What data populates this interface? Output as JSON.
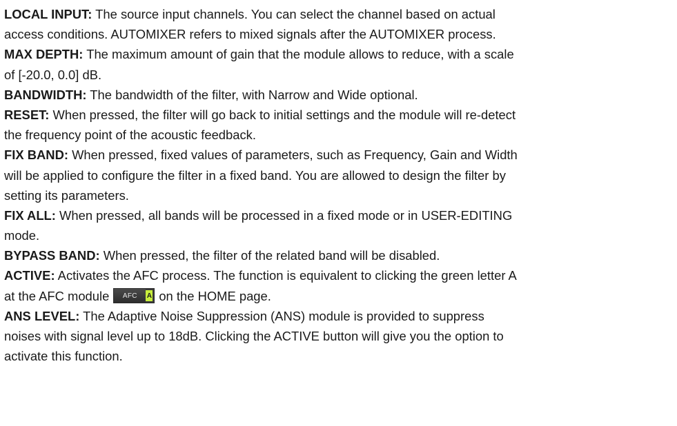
{
  "entries": [
    {
      "term": "LOCAL INPUT:",
      "lines": [
        " The source input channels. You can select the channel based on actual",
        "access conditions. AUTOMIXER refers to mixed signals after the AUTOMIXER process."
      ]
    },
    {
      "term": "MAX DEPTH:",
      "lines": [
        " The maximum amount of gain that the module allows to reduce, with a scale",
        "of [-20.0, 0.0] dB."
      ]
    },
    {
      "term": "BANDWIDTH:",
      "lines": [
        " The bandwidth of the filter, with Narrow and Wide optional."
      ]
    },
    {
      "term": "RESET:",
      "lines": [
        " When pressed, the filter will go back to initial settings and the module will re-detect",
        "the frequency point of the acoustic feedback."
      ]
    },
    {
      "term": "FIX BAND:",
      "lines": [
        " When pressed, fixed values of parameters, such as Frequency, Gain and Width",
        "will be applied to configure the filter in a fixed band. You are allowed to design the filter by",
        "setting its parameters."
      ]
    },
    {
      "term": "FIX ALL:",
      "lines": [
        " When pressed, all bands will be processed in a fixed mode or in USER-EDITING",
        "mode."
      ]
    },
    {
      "term": "BYPASS BAND:",
      "lines": [
        " When pressed, the filter of the related band will be disabled."
      ]
    },
    {
      "term": "ACTIVE:",
      "lines": [
        " Activates the AFC process. The function is equivalent to clicking the green letter A",
        "at the AFC module",
        "on the HOME page."
      ],
      "badge": {
        "label": "AFC",
        "letter": "A",
        "icon": "afc-module-icon",
        "letter_color": "#c8ee3c",
        "body_color": "#3a3a3a"
      }
    },
    {
      "term": "ANS LEVEL:",
      "lines": [
        " The Adaptive Noise Suppression (ANS) module is provided to suppress",
        "noises with signal level up to 18dB. Clicking the ACTIVE button will give you the option to",
        "activate this function."
      ]
    }
  ]
}
